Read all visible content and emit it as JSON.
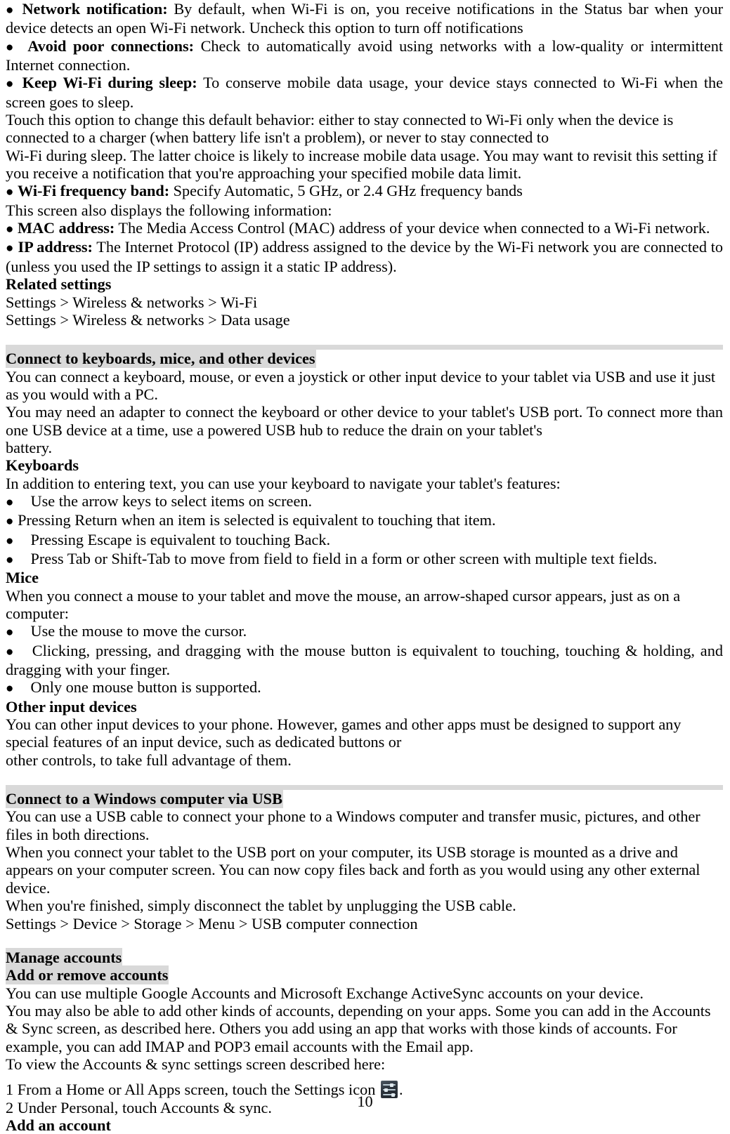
{
  "document": {
    "page_number": "10",
    "highlight_color": "#d9d9d9",
    "text_color": "#000000",
    "background_color": "#ffffff"
  },
  "icons": {
    "settings": "settings-icon",
    "bullet": "●"
  },
  "body": {
    "b1_label": "Network notification:",
    "b1_text": " By default, when Wi-Fi is on, you receive notifications in the Status bar when your device detects an open Wi-Fi network. Uncheck this option to turn off notifications",
    "b2_label": "Avoid poor connections:",
    "b2_text": " Check to automatically avoid using networks with a low-quality or intermittent Internet connection.",
    "b3_label": "Keep Wi-Fi during sleep:",
    "b3_text": " To conserve mobile data usage, your device stays connected to Wi-Fi when the screen goes to sleep.",
    "p1": "Touch this option to change this default behavior: either to stay connected to Wi-Fi only when the device is connected to a charger (when battery life isn't a problem), or never to stay connected to",
    "p2": "Wi-Fi during sleep. The latter choice is likely to increase mobile data usage. You may want to revisit this setting if you receive a notification that you're approaching your specified mobile data limit.",
    "b4_label": "Wi-Fi frequency band:",
    "b4_text": " Specify Automatic, 5 GHz, or 2.4 GHz frequency bands",
    "p3": "This screen also displays the following information:",
    "b5_label": "MAC address:",
    "b5_text": " The Media Access Control (MAC) address of your device when connected to a Wi-Fi network.",
    "b6_label": "IP address:",
    "b6_text": " The Internet Protocol (IP) address assigned to the device by the Wi-Fi network you are connected to (unless you used the IP settings to assign it a static IP address).",
    "h_related": "Related settings",
    "rel1": "Settings > Wireless & networks > Wi-Fi",
    "rel2": "Settings > Wireless & networks > Data usage",
    "h_connect_devices": "Connect to keyboards, mice, and other devices",
    "p4": "You can connect a keyboard, mouse, or even a joystick or other input device to your tablet via USB and use it just as you would with a PC.",
    "p5": "You may need an adapter to connect the keyboard or other device to your tablet's USB port. To connect more than one USB device at a time, use a powered USB hub to reduce the drain on your tablet's",
    "p6": "battery.",
    "h_keyboards": "Keyboards",
    "p7": "In addition to entering text, you can use your keyboard to navigate your tablet's features:",
    "kb1": "Use the arrow keys to select items on screen.",
    "kb2": "Pressing Return when an item is selected is equivalent to touching that item.",
    "kb3": "Pressing Escape is equivalent to touching Back.",
    "kb4": "Press Tab or Shift-Tab to move from field to field in a form or other screen with multiple text fields.",
    "h_mice": "Mice",
    "p8": "When you connect a mouse to your tablet and move the mouse, an arrow-shaped cursor appears, just as on a computer:",
    "m1": "Use the mouse to move the cursor.",
    "m2": "Clicking, pressing, and dragging with the mouse button is equivalent to touching, touching & holding, and dragging with your finger.",
    "m3": "Only one mouse button is supported.",
    "h_other_input": "Other input devices",
    "p9": "You can other input devices to your phone. However, games and other apps must be designed to support any special features of an input device, such as dedicated buttons or",
    "p10": "other controls, to take full advantage of them.",
    "h_usb": "Connect to a Windows computer via USB",
    "p11": "You can use a USB cable to connect your phone to a Windows computer and transfer music, pictures, and other files in both directions.",
    "p12": "When you connect your tablet to the USB port on your computer, its USB storage is mounted as a drive and appears on your computer screen. You can now copy files back and forth as you would using any other external device.",
    "p13": "When you're finished, simply disconnect the tablet by unplugging the USB cable.",
    "p14": "Settings > Device > Storage > Menu > USB computer connection",
    "h_manage_accounts": "Manage accounts",
    "h_add_remove": "Add or remove accounts",
    "p15": "You can use multiple Google Accounts and Microsoft Exchange ActiveSync accounts on your device.",
    "p16": "You may also be able to add other kinds of accounts, depending on your apps. Some you can add in the Accounts & Sync screen, as described here. Others you add using an app that works with those kinds of accounts. For example, you can add IMAP and POP3 email accounts with the Email app.",
    "p17": "To view the Accounts & sync settings screen described here:",
    "step1_pre": "1 From a Home or All Apps screen, touch the Settings icon ",
    "step1_post": ".",
    "step2": "2 Under Personal, touch Accounts & sync.",
    "h_add_account": "Add an account"
  }
}
